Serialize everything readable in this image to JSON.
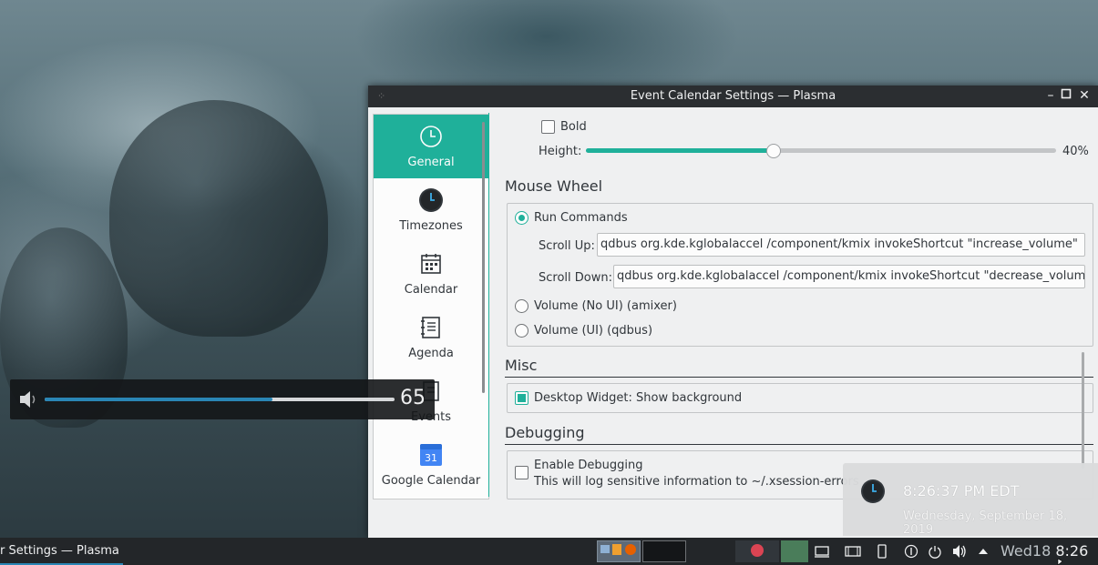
{
  "window": {
    "title": "Event Calendar Settings — Plasma"
  },
  "sidebar": {
    "items": [
      {
        "label": "General",
        "icon": "clock-icon",
        "active": true
      },
      {
        "label": "Timezones",
        "icon": "timezone-clock-icon",
        "active": false
      },
      {
        "label": "Calendar",
        "icon": "calendar-icon",
        "active": false
      },
      {
        "label": "Agenda",
        "icon": "agenda-icon",
        "active": false
      },
      {
        "label": "Events",
        "icon": "events-icon",
        "active": false
      },
      {
        "label": "Google Calendar",
        "icon": "google-calendar-icon",
        "active": false
      }
    ],
    "google_icon_text": "31"
  },
  "font": {
    "bold_label": "Bold",
    "height_label": "Height:",
    "height_value": "40%",
    "height_fraction": 0.4
  },
  "mouse_wheel": {
    "title": "Mouse Wheel",
    "run_commands_label": "Run Commands",
    "scroll_up_label": "Scroll Up:",
    "scroll_up_value": "qdbus org.kde.kglobalaccel /component/kmix invokeShortcut \"increase_volume\"",
    "scroll_down_label": "Scroll Down:",
    "scroll_down_value": "qdbus org.kde.kglobalaccel /component/kmix invokeShortcut \"decrease_volume\"",
    "amixer_label": "Volume (No UI) (amixer)",
    "qdbus_label": "Volume (UI) (qdbus)"
  },
  "misc": {
    "title": "Misc",
    "show_background_label": "Desktop Widget: Show background"
  },
  "debugging": {
    "title": "Debugging",
    "enable_label": "Enable Debugging",
    "enable_description": "This will log sensitive information to ~/.xsession-errors"
  },
  "osd": {
    "value": "65",
    "fraction": 0.65
  },
  "notification": {
    "time": "8:26:37 PM EDT",
    "date": "Wednesday, September 18, 2019"
  },
  "taskbar": {
    "task_label": "r Settings — Plasma",
    "clock_day": "Wed18",
    "clock_time": "8:26"
  },
  "colors": {
    "accent": "#1fb09a",
    "titlebar": "#2b2e31",
    "taskbar": "#232629"
  }
}
